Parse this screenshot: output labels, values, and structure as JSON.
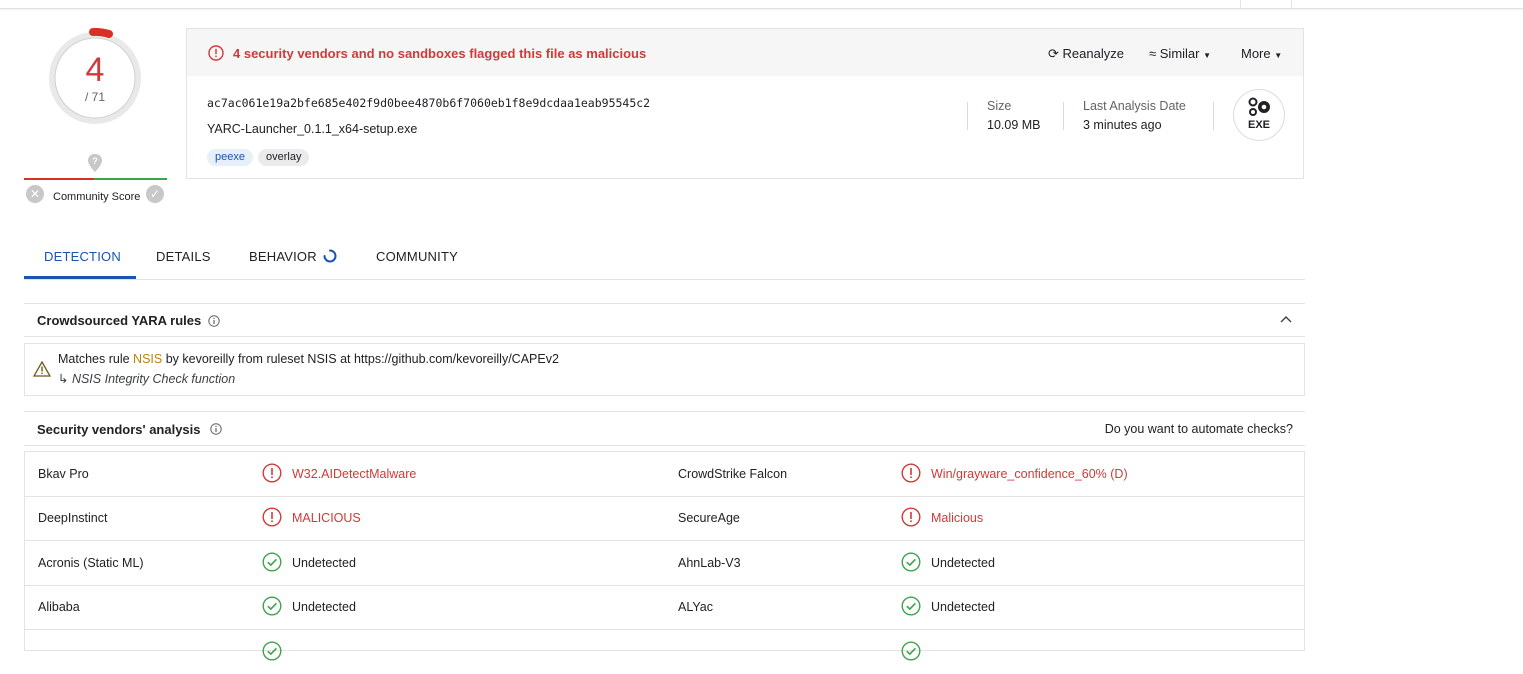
{
  "score": {
    "detections": "4",
    "total": "/ 71"
  },
  "community": {
    "label": "Community Score"
  },
  "alert": {
    "text": "4 security vendors and no sandboxes flagged this file as malicious"
  },
  "actions": {
    "reanalyze": "Reanalyze",
    "similar": "Similar",
    "more": "More"
  },
  "file": {
    "hash": "ac7ac061e19a2bfe685e402f9d0bee4870b6f7060eb1f8e9dcdaa1eab95545c2",
    "name": "YARC-Launcher_0.1.1_x64-setup.exe",
    "tags": [
      "peexe",
      "overlay"
    ],
    "size_label": "Size",
    "size_value": "10.09 MB",
    "last_analysis_label": "Last Analysis Date",
    "last_analysis_value": "3 minutes ago",
    "type_badge": "EXE"
  },
  "tabs": [
    "DETECTION",
    "DETAILS",
    "BEHAVIOR",
    "COMMUNITY"
  ],
  "yara": {
    "title": "Crowdsourced YARA rules",
    "match_prefix": "Matches rule",
    "rule_name": "NSIS",
    "match_suffix": "by kevoreilly from ruleset NSIS at https://github.com/kevoreilly/CAPEv2",
    "description": "↳ NSIS Integrity Check function"
  },
  "vendors": {
    "title": "Security vendors' analysis",
    "automate": "Do you want to automate checks?",
    "rows": [
      {
        "left_name": "Bkav Pro",
        "left_result": "W32.AIDetectMalware",
        "left_status": "malicious",
        "right_name": "CrowdStrike Falcon",
        "right_result": "Win/grayware_confidence_60% (D)",
        "right_status": "malicious"
      },
      {
        "left_name": "DeepInstinct",
        "left_result": "MALICIOUS",
        "left_status": "malicious",
        "right_name": "SecureAge",
        "right_result": "Malicious",
        "right_status": "malicious"
      },
      {
        "left_name": "Acronis (Static ML)",
        "left_result": "Undetected",
        "left_status": "undetected",
        "right_name": "AhnLab-V3",
        "right_result": "Undetected",
        "right_status": "undetected"
      },
      {
        "left_name": "Alibaba",
        "left_result": "Undetected",
        "left_status": "undetected",
        "right_name": "ALYac",
        "right_result": "Undetected",
        "right_status": "undetected"
      }
    ]
  },
  "colors": {
    "malicious": "#cf3a3a",
    "undetected": "#3fa34d",
    "accent": "#1a53b0"
  }
}
